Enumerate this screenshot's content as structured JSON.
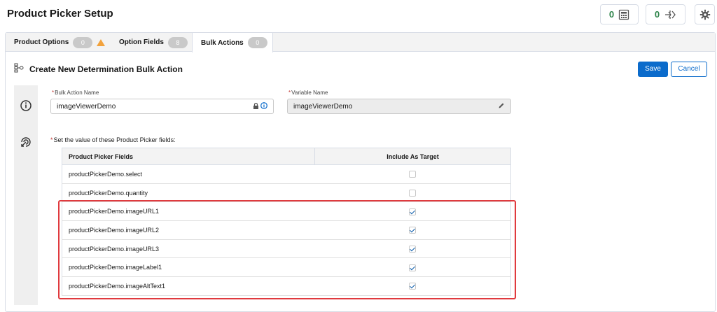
{
  "header": {
    "title": "Product Picker Setup",
    "counter1": "0",
    "counter1_icon": "calculator-icon",
    "counter2": "0",
    "counter2_icon": "flow-icon",
    "settings_icon": "gear-icon"
  },
  "tabs": [
    {
      "label": "Product Options",
      "count": "0",
      "warning": true,
      "active": false
    },
    {
      "label": "Option Fields",
      "count": "8",
      "warning": false,
      "active": false
    },
    {
      "label": "Bulk Actions",
      "count": "0",
      "warning": false,
      "active": true
    }
  ],
  "section": {
    "title": "Create New Determination Bulk Action",
    "icon": "hierarchy-icon",
    "save_label": "Save",
    "cancel_label": "Cancel"
  },
  "form": {
    "bulk_action_name_label": "Bulk Action Name",
    "bulk_action_name_value": "imageViewerDemo",
    "variable_name_label": "Variable Name",
    "variable_name_value": "imageViewerDemo",
    "instruction": "Set the value of these Product Picker fields:",
    "required_mark": "*"
  },
  "table": {
    "headers": [
      "Product Picker Fields",
      "Include As Target"
    ],
    "rows": [
      {
        "field": "productPickerDemo.select",
        "checked": false
      },
      {
        "field": "productPickerDemo.quantity",
        "checked": false
      },
      {
        "field": "productPickerDemo.imageURL1",
        "checked": true
      },
      {
        "field": "productPickerDemo.imageURL2",
        "checked": true
      },
      {
        "field": "productPickerDemo.imageURL3",
        "checked": true
      },
      {
        "field": "productPickerDemo.imageLabel1",
        "checked": true
      },
      {
        "field": "productPickerDemo.imageAltText1",
        "checked": true
      }
    ]
  },
  "colors": {
    "accent": "#0b6bcb",
    "success": "#2e844a",
    "highlight": "#e03a3e",
    "warning": "#f2a23c"
  }
}
